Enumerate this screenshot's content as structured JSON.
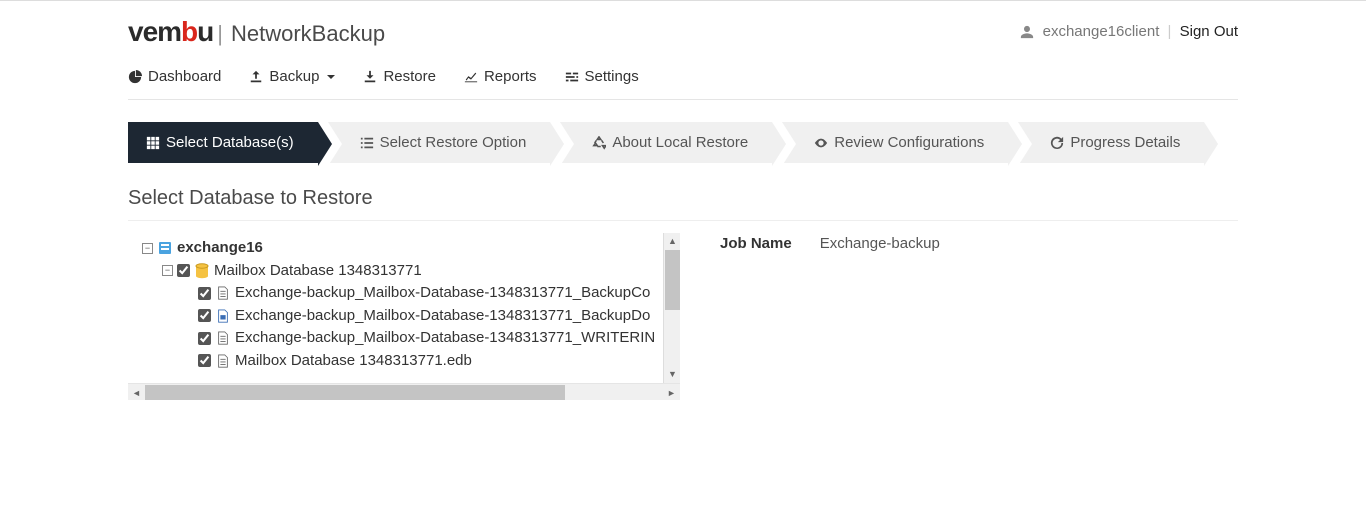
{
  "brand": {
    "name": "vembu",
    "product": "NetworkBackup"
  },
  "user": {
    "name": "exchange16client",
    "signout": "Sign Out"
  },
  "nav": {
    "dashboard": "Dashboard",
    "backup": "Backup",
    "restore": "Restore",
    "reports": "Reports",
    "settings": "Settings"
  },
  "wizard": {
    "step1": "Select Database(s)",
    "step2": "Select Restore Option",
    "step3": "About Local Restore",
    "step4": "Review Configurations",
    "step5": "Progress Details"
  },
  "section_title": "Select Database to Restore",
  "tree": {
    "root": "exchange16",
    "db": "Mailbox Database 1348313771",
    "files": [
      "Exchange-backup_Mailbox-Database-1348313771_BackupCo",
      "Exchange-backup_Mailbox-Database-1348313771_BackupDo",
      "Exchange-backup_Mailbox-Database-1348313771_WRITERIN",
      "Mailbox Database 1348313771.edb"
    ]
  },
  "info": {
    "job_name_label": "Job Name",
    "job_name_value": "Exchange-backup"
  }
}
